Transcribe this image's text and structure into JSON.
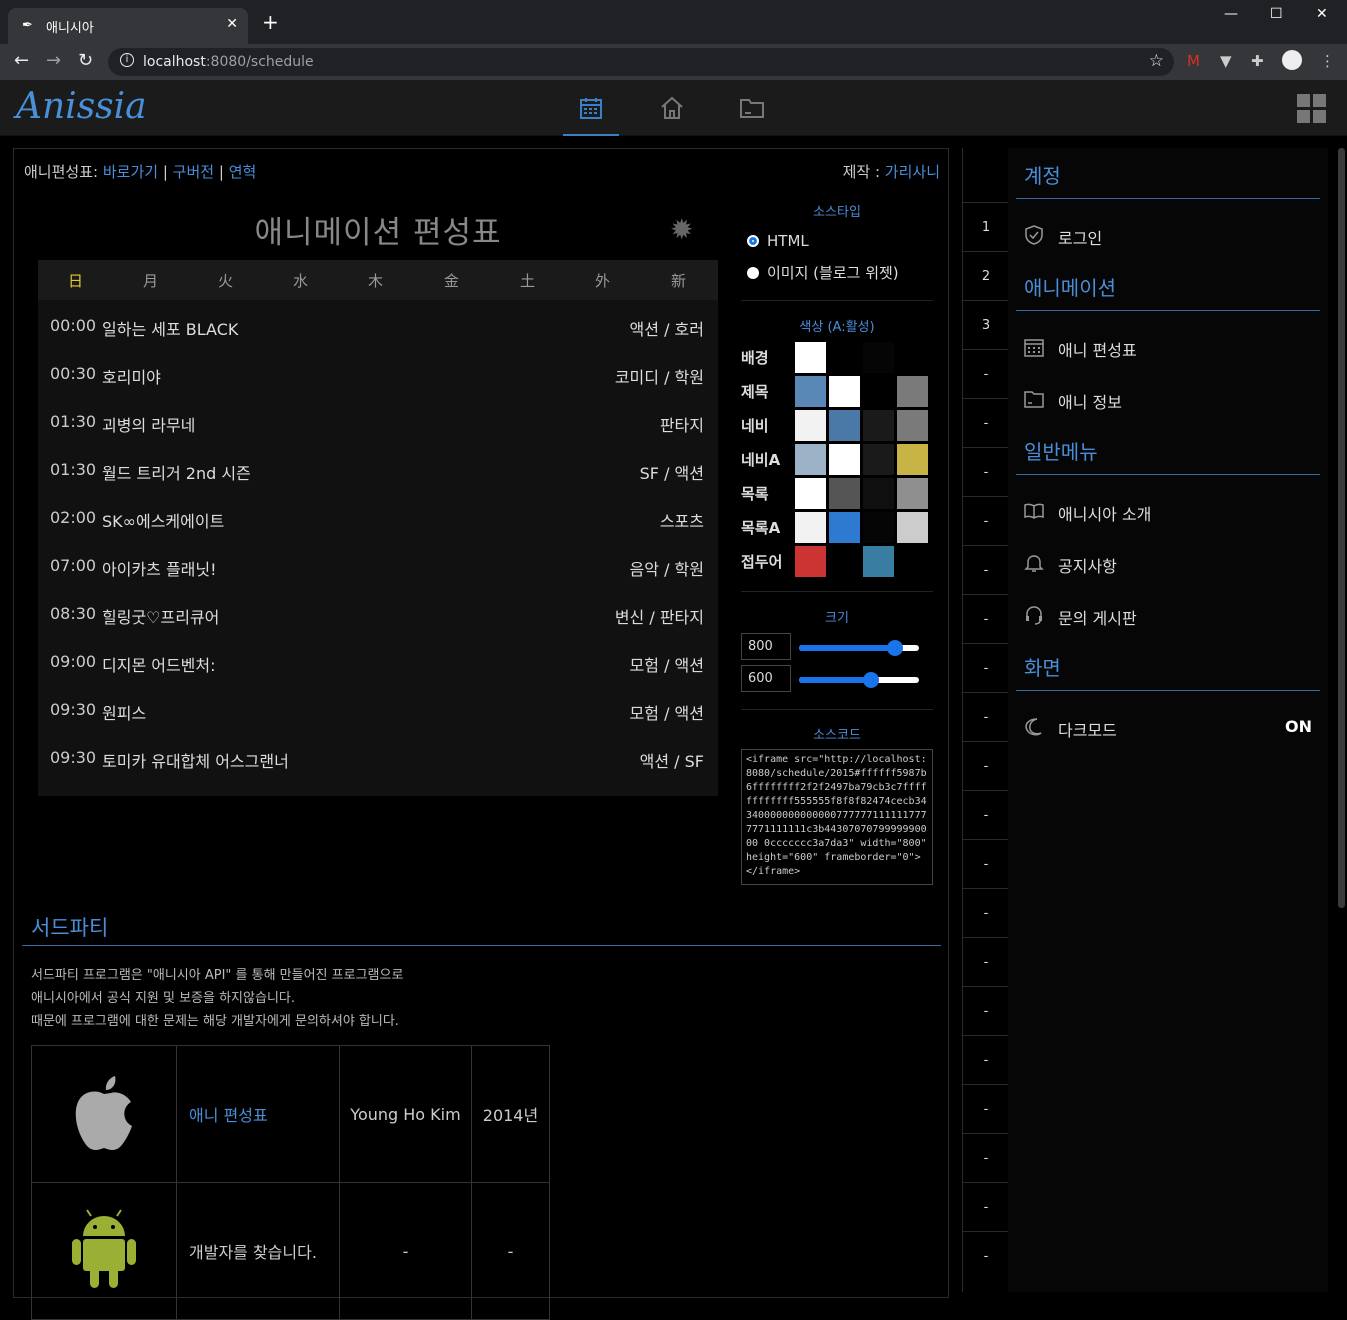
{
  "browser": {
    "tab_title": "애니시아",
    "tab_favicon": "anissia-favicon",
    "url_host": "localhost",
    "url_path": ":8080/schedule",
    "minimize": "—",
    "maximize": "☐",
    "close": "✕"
  },
  "app": {
    "logo": "Anissia",
    "nav": [
      "calendar-icon",
      "home-icon",
      "folder-icon"
    ],
    "active_nav": "calendar-icon"
  },
  "breadcrumb": {
    "prefix": "애니편성표:",
    "links": [
      "바로가기",
      "구버전",
      "연혁"
    ],
    "separator": "|",
    "maker_label": "제작 :",
    "maker_name": "가리사니"
  },
  "schedule": {
    "title": "애니메이션 편성표",
    "days": [
      "日",
      "月",
      "火",
      "水",
      "木",
      "金",
      "土",
      "外",
      "新"
    ],
    "today_index": 0,
    "rows": [
      {
        "time": "00:00",
        "name": "일하는 세포 BLACK",
        "genre": "액션 / 호러"
      },
      {
        "time": "00:30",
        "name": "호리미야",
        "genre": "코미디 / 학원"
      },
      {
        "time": "01:30",
        "name": "괴병의 라무네",
        "genre": "판타지"
      },
      {
        "time": "01:30",
        "name": "월드 트리거 2nd 시즌",
        "genre": "SF / 액션"
      },
      {
        "time": "02:00",
        "name": "SK∞에스케에이트",
        "genre": "스포츠"
      },
      {
        "time": "07:00",
        "name": "아이카츠 플래닛!",
        "genre": "음악 / 학원"
      },
      {
        "time": "08:30",
        "name": "힐링굿♡프리큐어",
        "genre": "변신 / 판타지"
      },
      {
        "time": "09:00",
        "name": "디지몬 어드벤처:",
        "genre": "모험 / 액션"
      },
      {
        "time": "09:30",
        "name": "원피스",
        "genre": "모험 / 액션"
      },
      {
        "time": "09:30",
        "name": "토미카 유대합체 어스그랜너",
        "genre": "액션 / SF"
      }
    ]
  },
  "options": {
    "source_type_title": "소스타입",
    "source_types": [
      "HTML",
      "이미지 (블로그 위젯)"
    ],
    "source_selected": 0,
    "color_title": "색상 (A:활성)",
    "color_rows": [
      {
        "label": "배경",
        "colors": [
          "#ffffff",
          "#000000",
          "#050505"
        ]
      },
      {
        "label": "제목",
        "colors": [
          "#5987b6",
          "#ffffff",
          "#000000",
          "#7a7a7a"
        ]
      },
      {
        "label": "네비",
        "colors": [
          "#f2f2f2",
          "#4a79a8",
          "#1a1a1a",
          "#7a7a7a"
        ]
      },
      {
        "label": "네비A",
        "colors": [
          "#9cb3c7",
          "#ffffff",
          "#1a1a1a",
          "#c8b445"
        ]
      },
      {
        "label": "목록",
        "colors": [
          "#ffffff",
          "#555555",
          "#0f0f0f",
          "#8f8f8f"
        ]
      },
      {
        "label": "목록A",
        "colors": [
          "#f2f2f2",
          "#2e7ad0",
          "#050505",
          "#cccccc"
        ]
      },
      {
        "label": "접두어",
        "colors": [
          "#cc3333",
          "#000000",
          "#3a7da3"
        ]
      }
    ],
    "size_title": "크기",
    "width": "800",
    "height": "600",
    "width_fraction": 0.8,
    "height_fraction": 0.6,
    "source_title": "소스코드",
    "source_code": "<iframe src=\"http://localhost:8080/schedule/2015#ffffff5987b6ffffffff2f2f2497ba79cb3c7ffffffffffff555555f8f8f82474cecb343400000000000007777771111117777771111111c3b4430707079999990000 0ccccccc3a7da3\" width=\"800\" height=\"600\" frameborder=\"0\"></iframe>"
  },
  "third_party": {
    "title": "서드파티",
    "lines": [
      "서드파티 프로그램은 \"애니시아 API\" 를 통해 만들어진 프로그램으로",
      "애니시아에서 공식 지원 및 보증을 하지않습니다.",
      "때문에 프로그램에 대한 문제는 해당 개발자에게 문의하셔야 합니다."
    ],
    "apps": [
      {
        "platform": "apple-logo-icon",
        "name": "애니 편성표",
        "author": "Young Ho Kim",
        "year": "2014년"
      },
      {
        "platform": "android-logo-icon",
        "name": "개발자를 찾습니다.",
        "author": "-",
        "year": "-"
      }
    ]
  },
  "ranks": [
    "1",
    "2",
    "3",
    "-",
    "-",
    "-",
    "-",
    "-",
    "-",
    "-",
    "-",
    "-",
    "-",
    "-",
    "-",
    "-",
    "-",
    "-",
    "-",
    "-",
    "-",
    "-"
  ],
  "sidebar": {
    "sections": [
      {
        "title": "계정",
        "items": [
          {
            "icon": "shield-icon",
            "label": "로그인"
          }
        ]
      },
      {
        "title": "애니메이션",
        "items": [
          {
            "icon": "calendar-icon",
            "label": "애니 편성표"
          },
          {
            "icon": "folder-icon",
            "label": "애니 정보"
          }
        ]
      },
      {
        "title": "일반메뉴",
        "items": [
          {
            "icon": "book-icon",
            "label": "애니시아 소개"
          },
          {
            "icon": "bell-icon",
            "label": "공지사항"
          },
          {
            "icon": "headset-icon",
            "label": "문의 게시판"
          }
        ]
      },
      {
        "title": "화면",
        "items": [
          {
            "icon": "moon-icon",
            "label": "다크모드"
          }
        ]
      }
    ],
    "dark_mode_state": "ON"
  }
}
